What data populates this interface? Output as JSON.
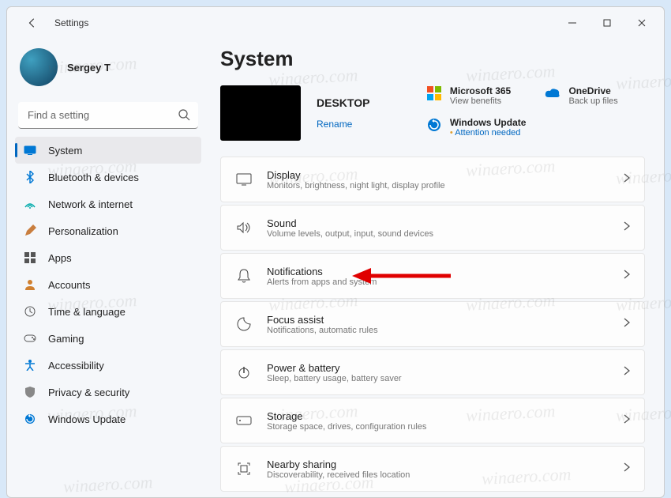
{
  "app": {
    "title": "Settings"
  },
  "user": {
    "name": "Sergey T"
  },
  "search": {
    "placeholder": "Find a setting"
  },
  "nav": [
    {
      "id": "system",
      "label": "System",
      "active": true
    },
    {
      "id": "bluetooth",
      "label": "Bluetooth & devices"
    },
    {
      "id": "network",
      "label": "Network & internet"
    },
    {
      "id": "personalization",
      "label": "Personalization"
    },
    {
      "id": "apps",
      "label": "Apps"
    },
    {
      "id": "accounts",
      "label": "Accounts"
    },
    {
      "id": "time",
      "label": "Time & language"
    },
    {
      "id": "gaming",
      "label": "Gaming"
    },
    {
      "id": "accessibility",
      "label": "Accessibility"
    },
    {
      "id": "privacy",
      "label": "Privacy & security"
    },
    {
      "id": "update",
      "label": "Windows Update"
    }
  ],
  "page": {
    "title": "System"
  },
  "device": {
    "name": "DESKTOP",
    "rename": "Rename"
  },
  "promo": {
    "m365": {
      "title": "Microsoft 365",
      "sub": "View benefits"
    },
    "onedrive": {
      "title": "OneDrive",
      "sub": "Back up files"
    },
    "update": {
      "title": "Windows Update",
      "sub": "Attention needed"
    }
  },
  "rows": [
    {
      "id": "display",
      "title": "Display",
      "sub": "Monitors, brightness, night light, display profile"
    },
    {
      "id": "sound",
      "title": "Sound",
      "sub": "Volume levels, output, input, sound devices"
    },
    {
      "id": "notifications",
      "title": "Notifications",
      "sub": "Alerts from apps and system"
    },
    {
      "id": "focus",
      "title": "Focus assist",
      "sub": "Notifications, automatic rules"
    },
    {
      "id": "power",
      "title": "Power & battery",
      "sub": "Sleep, battery usage, battery saver"
    },
    {
      "id": "storage",
      "title": "Storage",
      "sub": "Storage space, drives, configuration rules"
    },
    {
      "id": "nearby",
      "title": "Nearby sharing",
      "sub": "Discoverability, received files location"
    }
  ],
  "watermark": "winaero.com"
}
